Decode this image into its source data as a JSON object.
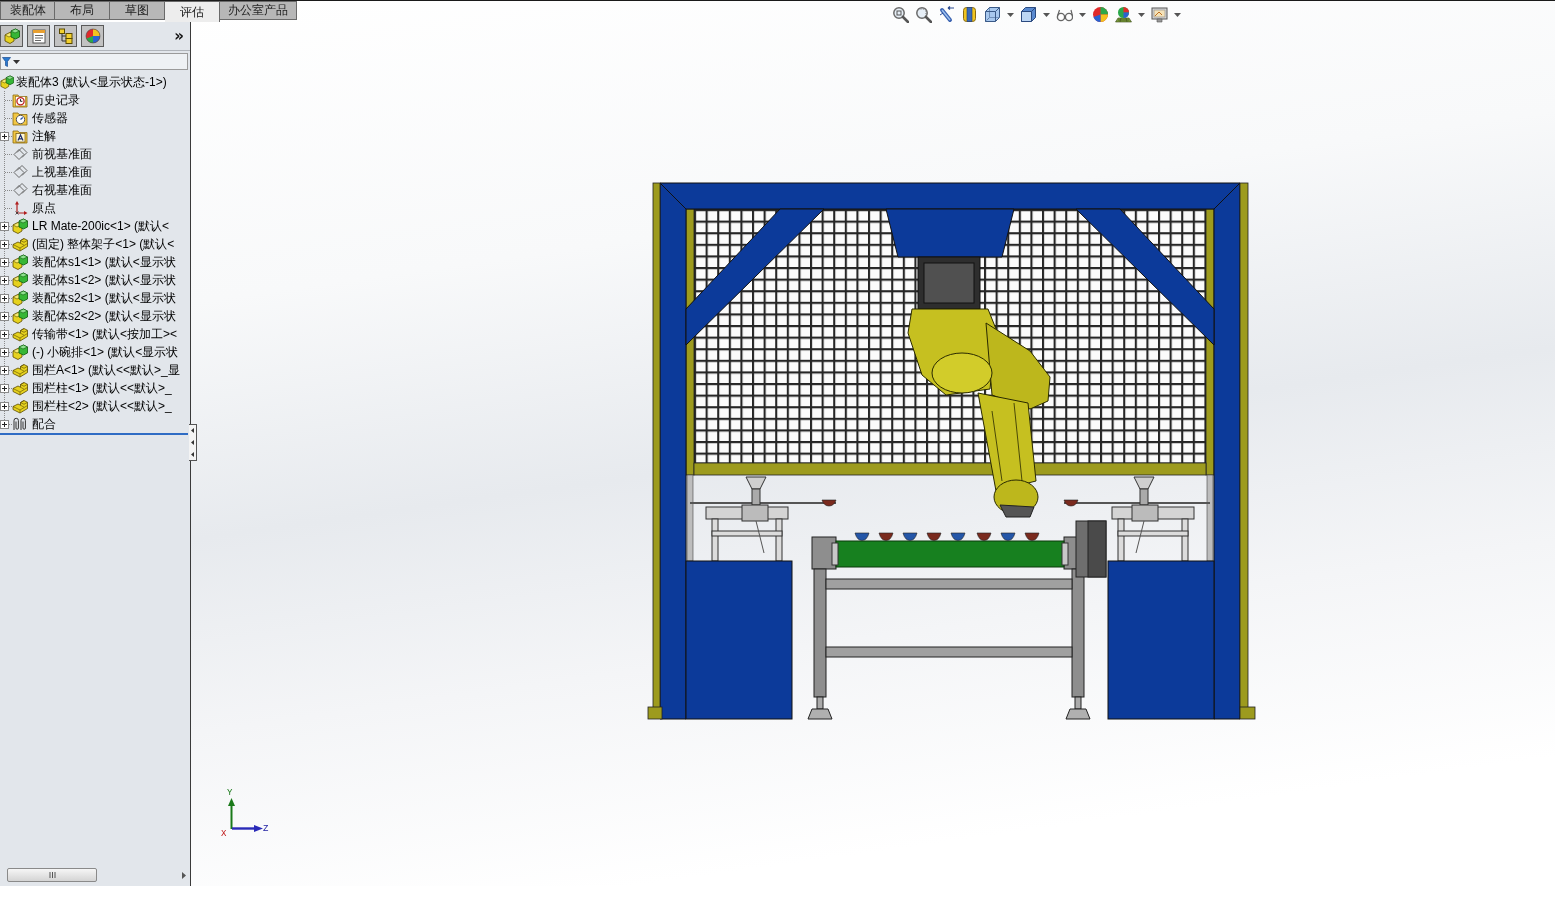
{
  "command_tabs": [
    {
      "label": "装配体",
      "selected": false
    },
    {
      "label": "布局",
      "selected": false
    },
    {
      "label": "草图",
      "selected": false
    },
    {
      "label": "评估",
      "selected": true
    },
    {
      "label": "办公室产品",
      "selected": false
    }
  ],
  "feature_manager": {
    "more_button": "»",
    "tree": [
      {
        "kind": "assembly",
        "label": "装配体3 (默认<显示状态-1>)",
        "children": [
          {
            "kind": "history",
            "label": "历史记录"
          },
          {
            "kind": "sensor",
            "label": "传感器"
          },
          {
            "kind": "annotation",
            "label": "注解",
            "expanded": false
          },
          {
            "kind": "plane",
            "label": "前视基准面"
          },
          {
            "kind": "plane",
            "label": "上视基准面"
          },
          {
            "kind": "plane",
            "label": "右视基准面"
          },
          {
            "kind": "origin",
            "label": "原点"
          },
          {
            "kind": "assembly",
            "label": "LR Mate-200ic<1> (默认<",
            "expanded": false
          },
          {
            "kind": "part",
            "label": "(固定) 整体架子<1> (默认<",
            "expanded": false
          },
          {
            "kind": "assembly",
            "label": "装配体s1<1> (默认<显示状",
            "expanded": false
          },
          {
            "kind": "assembly",
            "label": "装配体s1<2> (默认<显示状",
            "expanded": false
          },
          {
            "kind": "assembly",
            "label": "装配体s2<1> (默认<显示状",
            "expanded": false
          },
          {
            "kind": "assembly",
            "label": "装配体s2<2> (默认<显示状",
            "expanded": false
          },
          {
            "kind": "part",
            "label": "传输带<1> (默认<按加工><",
            "expanded": false
          },
          {
            "kind": "assembly",
            "label": "(-) 小碗排<1> (默认<显示状",
            "expanded": false
          },
          {
            "kind": "part",
            "label": "围栏A<1> (默认<<默认>_显",
            "expanded": false
          },
          {
            "kind": "part",
            "label": "围栏柱<1> (默认<<默认>_",
            "expanded": false
          },
          {
            "kind": "part",
            "label": "围栏柱<2> (默认<<默认>_",
            "expanded": false
          },
          {
            "kind": "mates",
            "label": "配合",
            "expanded": false
          }
        ]
      }
    ]
  },
  "view_triad": {
    "x": "X",
    "y": "Y",
    "z": "Z"
  }
}
